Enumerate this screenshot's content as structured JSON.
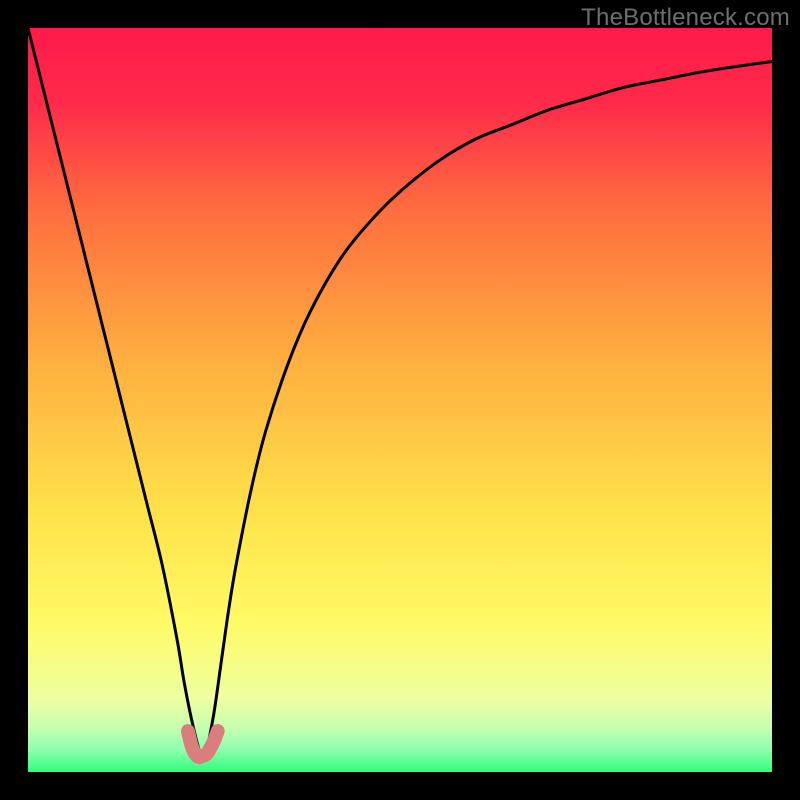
{
  "watermark": {
    "text": "TheBottleneck.com"
  },
  "chart_data": {
    "type": "line",
    "title": "",
    "xlabel": "",
    "ylabel": "",
    "xlim": [
      0,
      100
    ],
    "ylim": [
      0,
      100
    ],
    "grid": false,
    "legend": false,
    "series": [
      {
        "name": "bottleneck-curve",
        "x": [
          0,
          2,
          4,
          6,
          8,
          10,
          12,
          14,
          16,
          18,
          20,
          21,
          22,
          23,
          23.5,
          24,
          25,
          26,
          27,
          28,
          30,
          32,
          35,
          38,
          42,
          46,
          50,
          55,
          60,
          65,
          70,
          75,
          80,
          85,
          90,
          95,
          100
        ],
        "values": [
          100,
          92,
          84,
          76,
          68,
          60,
          52,
          44,
          36,
          28,
          18,
          12,
          7,
          3,
          2.2,
          3,
          8,
          15,
          22,
          28,
          38,
          46,
          55,
          62,
          69,
          74,
          78,
          82,
          85,
          87,
          89,
          90.5,
          92,
          93,
          94,
          94.8,
          95.5
        ]
      },
      {
        "name": "optimal-range-highlight",
        "x": [
          21.5,
          22,
          22.5,
          23,
          23.5,
          24,
          24.5,
          25,
          25.5
        ],
        "values": [
          5.5,
          3.5,
          2.4,
          2.0,
          2.2,
          2.4,
          3.2,
          4.2,
          5.5
        ]
      }
    ],
    "background_gradient": {
      "type": "vertical",
      "stops": [
        {
          "pos": 0.0,
          "color": "#ff1a4b"
        },
        {
          "pos": 0.1,
          "color": "#ff2a4a"
        },
        {
          "pos": 0.25,
          "color": "#ff6f3f"
        },
        {
          "pos": 0.45,
          "color": "#ffb040"
        },
        {
          "pos": 0.65,
          "color": "#ffe24a"
        },
        {
          "pos": 0.8,
          "color": "#fffb66"
        },
        {
          "pos": 0.9,
          "color": "#efffa0"
        },
        {
          "pos": 0.94,
          "color": "#c7ffb0"
        },
        {
          "pos": 0.97,
          "color": "#8effb0"
        },
        {
          "pos": 1.0,
          "color": "#2fff7a"
        }
      ]
    },
    "curve_stroke": "#000000",
    "highlight_stroke": "#d97d7d"
  }
}
